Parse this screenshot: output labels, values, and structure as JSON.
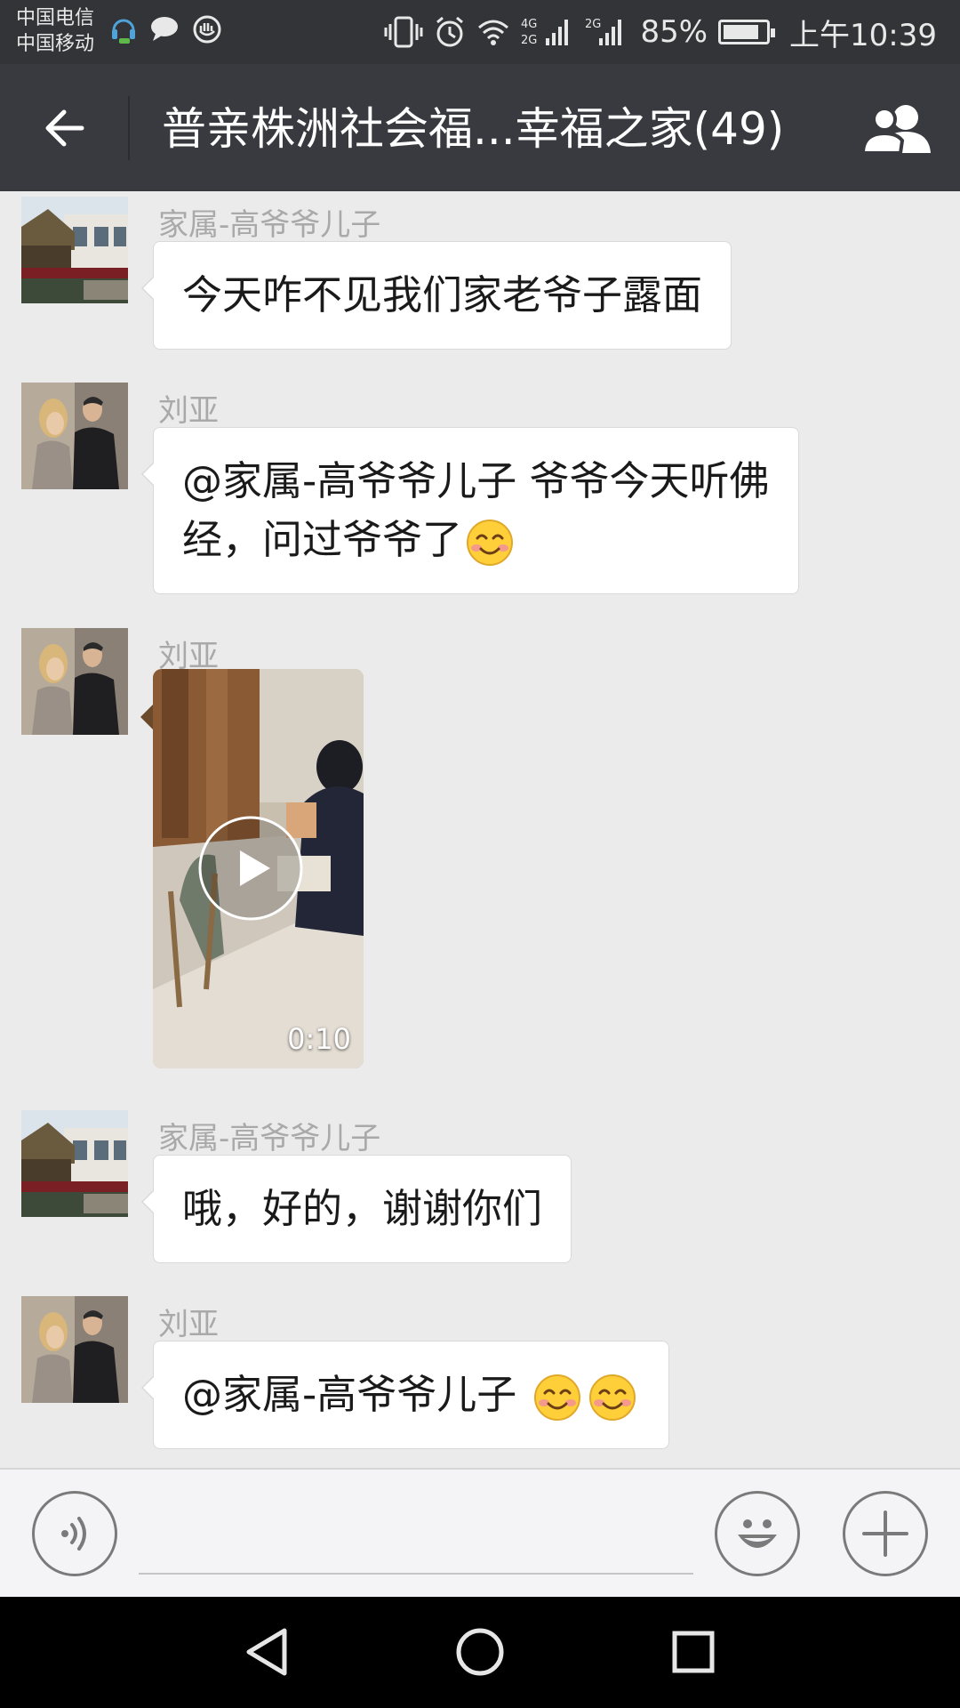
{
  "status_bar": {
    "carrier_1": "中国电信",
    "carrier_2": "中国移动",
    "network_1": "4G",
    "network_2": "2G",
    "network_3": "2G",
    "battery_text": "85%",
    "battery_level": 0.85,
    "time": "上午10:39"
  },
  "header": {
    "title": "普亲株洲社会福...幸福之家(49)",
    "back_icon": "arrow-left-icon",
    "members_icon": "group-members-icon"
  },
  "messages": [
    {
      "type": "text",
      "sender": "家属-高爷爷儿子",
      "avatar": "house-avatar",
      "text": "今天咋不见我们家老爷子露面"
    },
    {
      "type": "text",
      "sender": "刘亚",
      "avatar": "couple-avatar",
      "line1": "@家属-高爷爷儿子 爷爷今天听佛",
      "line2": "经，问过爷爷了",
      "emoji": "smiling-face-icon"
    },
    {
      "type": "video",
      "sender": "刘亚",
      "avatar": "couple-avatar",
      "duration": "0:10"
    },
    {
      "type": "text",
      "sender": "家属-高爷爷儿子",
      "avatar": "house-avatar",
      "text": "哦，好的，谢谢你们"
    },
    {
      "type": "text",
      "sender": "刘亚",
      "avatar": "couple-avatar",
      "text": "@家属-高爷爷儿子 ",
      "emoji_count": 2
    }
  ],
  "input_bar": {
    "voice_icon": "voice-icon",
    "placeholder": "",
    "emoji_icon": "emoji-icon",
    "plus_icon": "plus-icon"
  },
  "nav_bar": {
    "back_icon": "triangle-back-icon",
    "home_icon": "circle-home-icon",
    "recents_icon": "square-recents-icon"
  },
  "colors": {
    "status_bar": "#323437",
    "title_bar": "#393a3f",
    "chat_background": "#ebebeb",
    "bubble": "#ffffff",
    "sender_name": "#a9a9a9"
  }
}
